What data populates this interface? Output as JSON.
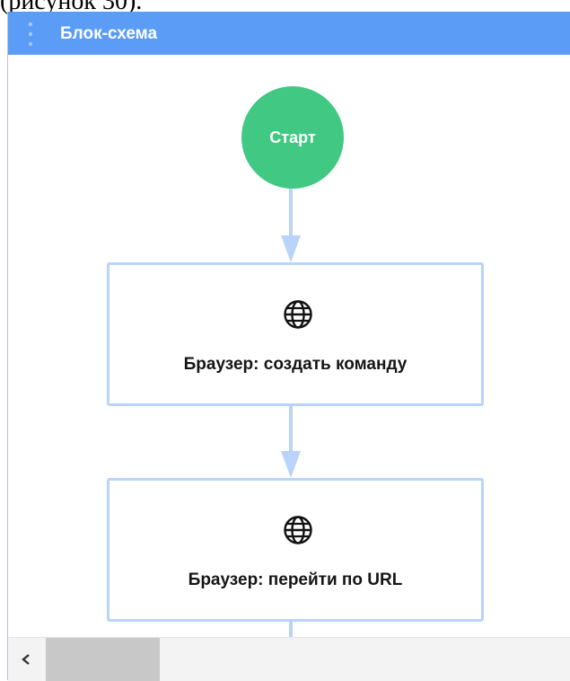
{
  "caption_fragment": "(рисунок 30).",
  "panel": {
    "title": "Блок-схема"
  },
  "flowchart": {
    "start_label": "Старт",
    "nodes": [
      {
        "icon": "globe-icon",
        "label": "Браузер: создать команду"
      },
      {
        "icon": "globe-icon",
        "label": "Браузер: перейти по URL"
      }
    ]
  },
  "colors": {
    "header": "#5b9cf6",
    "start_node": "#41c882",
    "connector": "#b9d3fb",
    "node_border": "#b9d3fb"
  },
  "scrollbar": {
    "left_arrow_icon": "chevron-left-icon"
  }
}
